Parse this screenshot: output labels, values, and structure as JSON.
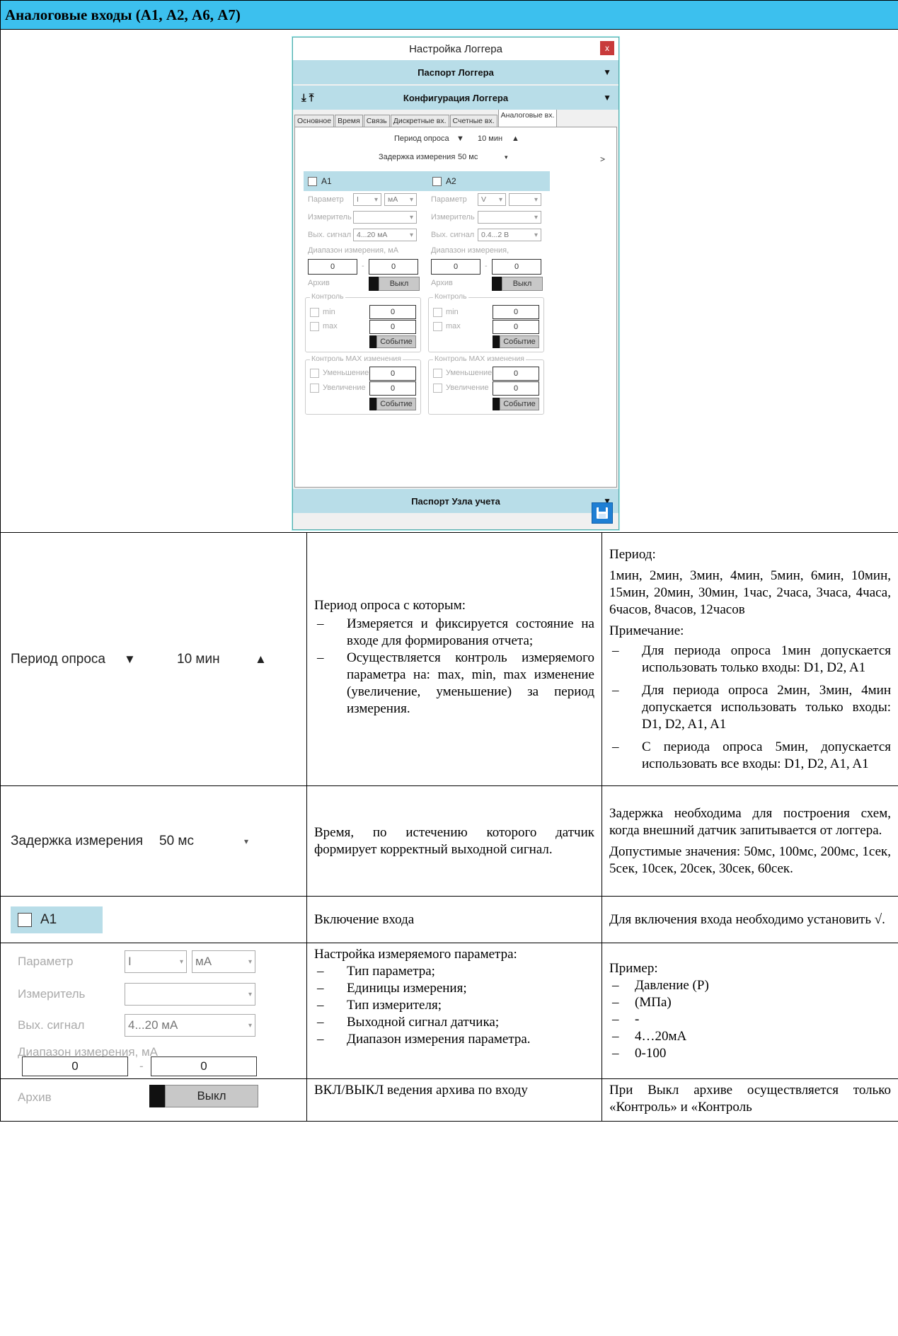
{
  "header": {
    "title": "Аналоговые входы (А1, А2, А6, А7)"
  },
  "window": {
    "title": "Настройка Логгера",
    "close": "x",
    "band_passport": "Паспорт Логгера",
    "band_config": "Конфигурация Логгера",
    "band_node": "Паспорт Узла учета",
    "band_arrow": "▼",
    "tabs": [
      "Основное",
      "Время",
      "Связь",
      "Дискретные вх.",
      "Счетные вх.",
      "Аналоговые вх."
    ],
    "period_label": "Период опроса",
    "period_down": "▼",
    "period_value": "10 мин",
    "period_up": "▲",
    "delay_label": "Задержка измерения",
    "delay_value": "50 мс",
    "next": ">",
    "ch1": {
      "name": "A1",
      "param_label": "Параметр",
      "param_value": "I",
      "unit_value": "мА",
      "meter_label": "Измеритель",
      "out_label": "Вых. сигнал",
      "out_value": "4...20 мА",
      "range_label": "Диапазон измерения, мА",
      "range_min": "0",
      "range_max": "0",
      "archive_label": "Архив",
      "archive_btn": "Выкл",
      "control_label": "Контроль",
      "min_label": "min",
      "max_label": "max",
      "min_value": "0",
      "max_value": "0",
      "event_btn": "Событие",
      "maxchg_label": "Контроль MAX изменения",
      "dec_label": "Уменьшение",
      "inc_label": "Увеличение",
      "dec_value": "0",
      "inc_value": "0",
      "event_btn2": "Событие"
    },
    "ch2": {
      "name": "A2",
      "param_label": "Параметр",
      "param_value": "V",
      "unit_value": "",
      "meter_label": "Измеритель",
      "out_label": "Вых. сигнал",
      "out_value": "0.4...2 В",
      "range_label": "Диапазон измерения,",
      "range_min": "0",
      "range_max": "0",
      "archive_label": "Архив",
      "archive_btn": "Выкл",
      "control_label": "Контроль",
      "min_label": "min",
      "max_label": "max",
      "min_value": "0",
      "max_value": "0",
      "event_btn": "Событие",
      "maxchg_label": "Контроль MAX изменения",
      "dec_label": "Уменьшение",
      "inc_label": "Увеличение",
      "dec_value": "0",
      "inc_value": "0",
      "event_btn2": "Событие"
    }
  },
  "rows": {
    "period": {
      "snip_label": "Период опроса",
      "snip_down": "▼",
      "snip_value": "10 мин",
      "snip_up": "▲",
      "desc_intro": "Период опроса с которым:",
      "desc_items": [
        "Измеряется и фиксируется состояние на входе для формирования отчета;",
        "Осуществляется контроль измеряемого параметра на: max, min, max изменение (увеличение, уменьшение) за период измерения."
      ],
      "note_title": "Период:",
      "note_values": "1мин, 2мин, 3мин, 4мин, 5мин, 6мин, 10мин, 15мин, 20мин, 30мин, 1час, 2часа, 3часа, 4часа, 6часов, 8часов, 12часов",
      "note_sub": "Примечание:",
      "note_items": [
        "Для периода опроса 1мин допускается использовать только входы: D1, D2, A1",
        "Для периода опроса 2мин, 3мин, 4мин допускается использовать только входы: D1, D2, A1, A1",
        "С периода опроса 5мин, допускается использовать все входы: D1, D2, A1, A1"
      ]
    },
    "delay": {
      "snip_label": "Задержка измерения",
      "snip_value": "50 мс",
      "desc": "Время, по истечению которого датчик формирует корректный выходной сигнал.",
      "note1": "Задержка необходима для построения схем, когда внешний датчик запитывается от логгера.",
      "note2": "Допустимые значения: 50мс, 100мс, 200мс, 1сек, 5сек, 10сек, 20сек, 30сек, 60сек."
    },
    "enable": {
      "snip_label": "A1",
      "desc": "Включение входа",
      "note": "Для включения входа необходимо установить √."
    },
    "param": {
      "snip_param": "Параметр",
      "snip_param_val": "I",
      "snip_unit": "мА",
      "snip_meter": "Измеритель",
      "snip_out": "Вых. сигнал",
      "snip_out_val": "4...20 мА",
      "snip_range": "Диапазон измерения, мА",
      "snip_min": "0",
      "snip_max": "0",
      "desc_intro": "Настройка измеряемого параметра:",
      "desc_items": [
        "Тип параметра;",
        "Единицы измерения;",
        "Тип измерителя;",
        "Выходной сигнал датчика;",
        "Диапазон измерения параметра."
      ],
      "note_title": "Пример:",
      "note_items": [
        "Давление (Р)",
        "(МПа)",
        "-",
        "4…20мА",
        "0-100"
      ]
    },
    "archive": {
      "snip_label": "Архив",
      "snip_btn": "Выкл",
      "desc": "ВКЛ/ВЫКЛ ведения архива по входу",
      "note": "При Выкл архиве осуществляется только «Контроль» и «Контроль"
    }
  }
}
